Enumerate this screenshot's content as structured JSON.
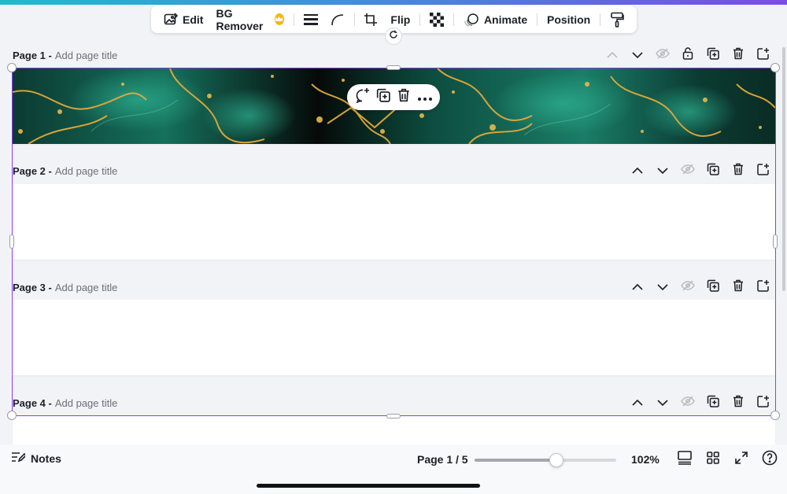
{
  "toolbar": {
    "edit_label": "Edit",
    "bg_remover_label": "BG Remover",
    "flip_label": "Flip",
    "animate_label": "Animate",
    "position_label": "Position"
  },
  "pages": [
    {
      "number_label": "Page 1 -",
      "title_placeholder": "Add page title"
    },
    {
      "number_label": "Page 2 -",
      "title_placeholder": "Add page title"
    },
    {
      "number_label": "Page 3 -",
      "title_placeholder": "Add page title"
    },
    {
      "number_label": "Page 4 -",
      "title_placeholder": "Add page title"
    }
  ],
  "bottombar": {
    "notes_label": "Notes",
    "page_indicator": "Page 1 / 5",
    "zoom_label": "102%",
    "zoom_fraction": 0.58
  },
  "colors": {
    "accent": "#8b3dff",
    "banner_green": "#0f5e4e",
    "banner_gold": "#e2a93a"
  }
}
